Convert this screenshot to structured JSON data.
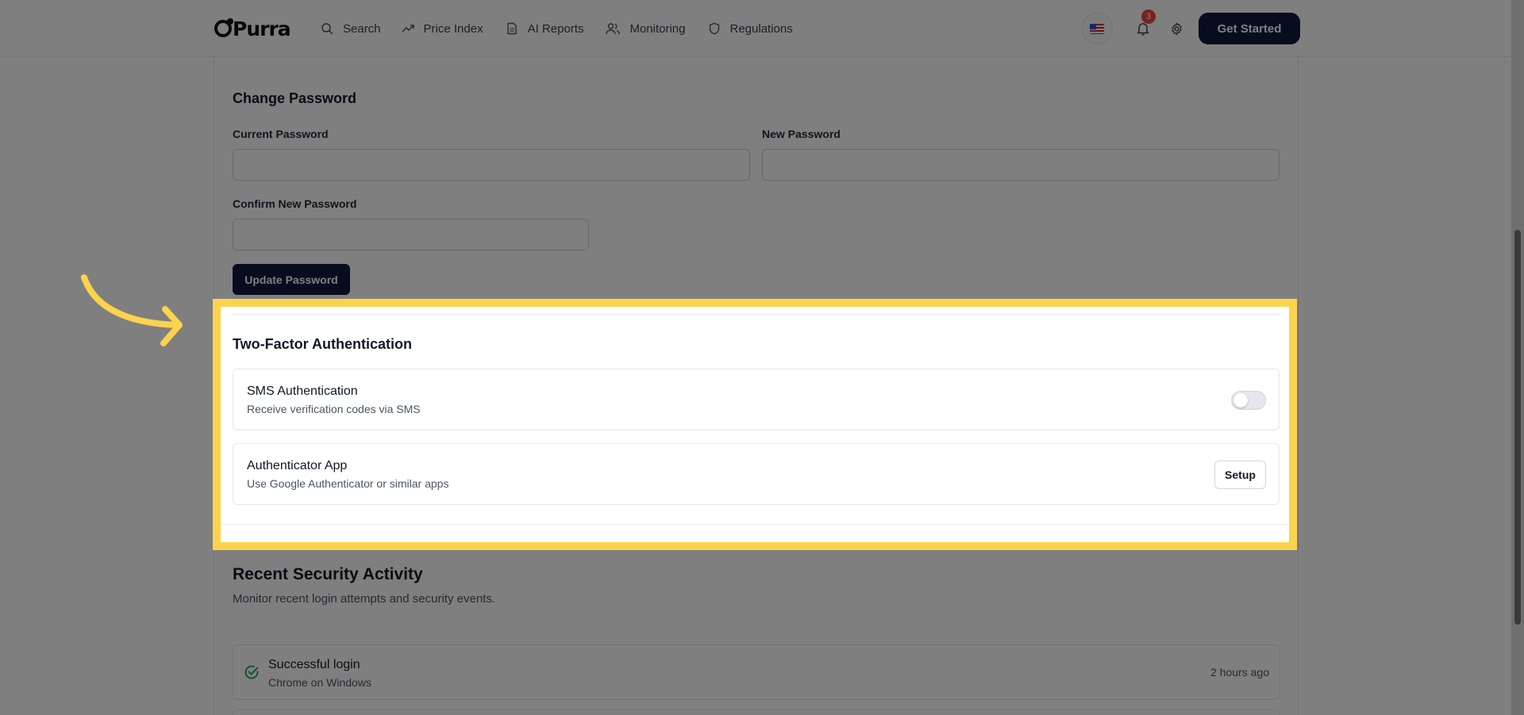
{
  "header": {
    "logo_text": "Purra",
    "nav": [
      {
        "label": "Search",
        "icon": "search-icon"
      },
      {
        "label": "Price Index",
        "icon": "trending-up-icon"
      },
      {
        "label": "AI Reports",
        "icon": "document-icon"
      },
      {
        "label": "Monitoring",
        "icon": "users-icon"
      },
      {
        "label": "Regulations",
        "icon": "shield-icon"
      }
    ],
    "notification_count": "3",
    "cta_label": "Get Started"
  },
  "change_password": {
    "title": "Change Password",
    "current_label": "Current Password",
    "new_label": "New Password",
    "confirm_label": "Confirm New Password",
    "update_button": "Update Password"
  },
  "two_factor": {
    "title": "Two-Factor Authentication",
    "sms": {
      "title": "SMS Authentication",
      "description": "Receive verification codes via SMS",
      "enabled": false
    },
    "app": {
      "title": "Authenticator App",
      "description": "Use Google Authenticator or similar apps",
      "button": "Setup"
    }
  },
  "activity": {
    "title": "Recent Security Activity",
    "subtitle": "Monitor recent login attempts and security events.",
    "items": [
      {
        "title": "Successful login",
        "description": "Chrome on Windows",
        "time": "2 hours ago",
        "icon": "check-circle-icon"
      }
    ]
  },
  "colors": {
    "highlight": "#fcd34d",
    "primary": "#0f1b3d"
  }
}
